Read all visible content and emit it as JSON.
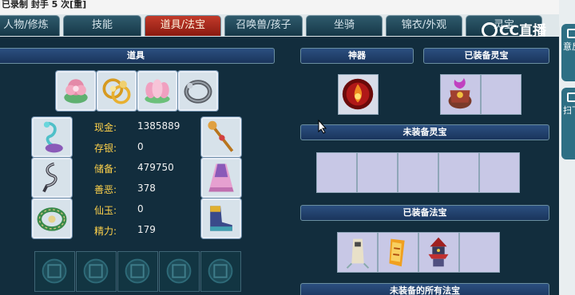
{
  "window": {
    "title_fragment": "已录制 封手 5 次[重]"
  },
  "tabs": [
    {
      "label": "人物/修炼",
      "active": false
    },
    {
      "label": "技能",
      "active": false
    },
    {
      "label": "道具/法宝",
      "active": true
    },
    {
      "label": "召唤兽/孩子",
      "active": false
    },
    {
      "label": "坐骑",
      "active": false
    },
    {
      "label": "锦衣/外观",
      "active": false
    },
    {
      "label": "灵宝",
      "active": false
    }
  ],
  "watermark": "CC直播",
  "side_buttons": [
    {
      "label": "意反"
    },
    {
      "label": "扫下"
    }
  ],
  "items_section": {
    "title": "道具",
    "top_items": [
      {
        "icon": "pink-flower-item"
      },
      {
        "icon": "gold-ornament-item"
      },
      {
        "icon": "lotus-item"
      },
      {
        "icon": "silver-ring-item"
      }
    ],
    "left_equipment": [
      {
        "icon": "ghost-hairpin-item"
      },
      {
        "icon": "belt-item"
      },
      {
        "icon": "jade-necklace-item"
      }
    ],
    "right_equipment": [
      {
        "icon": "staff-weapon-item"
      },
      {
        "icon": "pink-robe-item"
      },
      {
        "icon": "boots-item"
      }
    ],
    "stats": [
      {
        "label": "现金:",
        "value": "1385889"
      },
      {
        "label": "存银:",
        "value": "0"
      },
      {
        "label": "储备:",
        "value": "479750"
      },
      {
        "label": "善恶:",
        "value": "378"
      },
      {
        "label": "仙玉:",
        "value": "0"
      },
      {
        "label": "精力:",
        "value": "179"
      }
    ]
  },
  "artifact_section": {
    "title": "神器"
  },
  "equipped_lingbao": {
    "title": "已装备灵宝"
  },
  "unequipped_lingbao": {
    "title": "未装备灵宝"
  },
  "equipped_fabao": {
    "title": "已装备法宝"
  },
  "all_fabao": {
    "title": "未装备的所有法宝"
  },
  "colors": {
    "active_tab": "#b52f22",
    "stat_label": "#ffd24a",
    "section_bar": "#23446e",
    "slot_fill": "#c8c8e6"
  }
}
